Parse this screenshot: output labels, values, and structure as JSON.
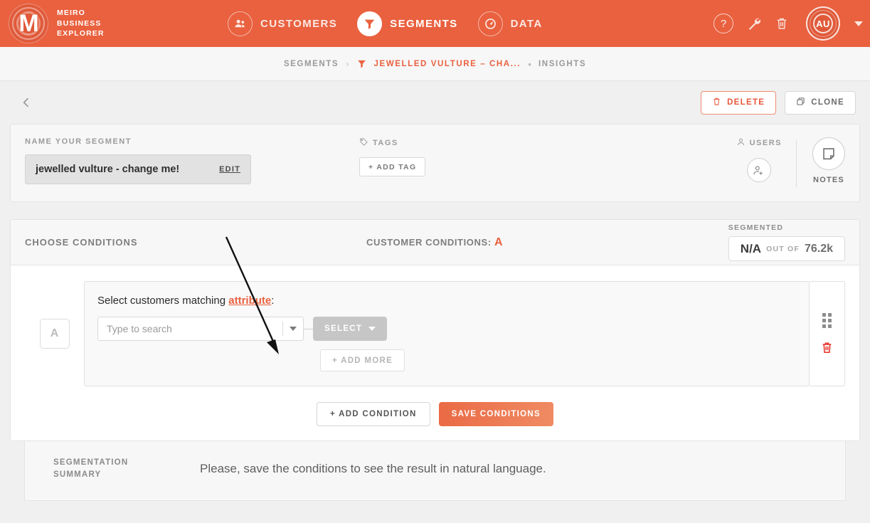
{
  "brand": {
    "logo_icon": "meiro-logo-icon",
    "logo_letter": "M",
    "line1": "MEIRO",
    "line2": "BUSINESS",
    "line3": "EXPLORER"
  },
  "topnav": {
    "items": [
      {
        "label": "CUSTOMERS",
        "icon": "customers-group-icon",
        "active": false
      },
      {
        "label": "SEGMENTS",
        "icon": "funnel-icon",
        "active": true
      },
      {
        "label": "DATA",
        "icon": "gauge-icon",
        "active": false
      }
    ],
    "help_icon": "question-mark-icon",
    "wrench_icon": "wrench-icon",
    "trash_icon": "trash-icon",
    "avatar_initials": "AU",
    "avatar_caret_icon": "chevron-down-icon"
  },
  "breadcrumb": {
    "root": "SEGMENTS",
    "separator": "›",
    "funnel_icon": "funnel-icon",
    "current": "JEWELLED VULTURE – CHA...",
    "dot": "•",
    "tail": "INSIGHTS"
  },
  "actionbar": {
    "back_icon": "chevron-left-icon",
    "delete_label": "DELETE",
    "delete_icon": "trash-icon",
    "clone_label": "CLONE",
    "clone_icon": "copy-icon"
  },
  "info": {
    "name_label": "NAME YOUR SEGMENT",
    "name_value": "jewelled vulture - change me!",
    "edit_label": "EDIT",
    "tags_label": "TAGS",
    "tags_icon": "tag-icon",
    "add_tag_label": "+  ADD TAG",
    "users_label": "USERS",
    "users_icon": "user-icon",
    "add_user_icon": "add-user-icon",
    "notes_label": "NOTES",
    "notes_icon": "note-icon"
  },
  "conditions": {
    "choose_label": "CHOOSE CONDITIONS",
    "customer_conditions_label": "CUSTOMER CONDITIONS:",
    "customer_conditions_letter": "A",
    "segmented_label": "SEGMENTED",
    "segmented_value": "N/A",
    "segmented_out_of": "OUT OF",
    "segmented_total": "76.2k",
    "row": {
      "letter": "A",
      "sentence_prefix": "Select customers matching ",
      "sentence_link": "attribute",
      "sentence_suffix": ":",
      "search_placeholder": "Type to search",
      "search_value": "",
      "search_caret_icon": "chevron-down-icon",
      "select_label": "SELECT",
      "select_caret_icon": "chevron-down-icon",
      "add_more_label": "+ ADD MORE",
      "drag_icon": "drag-handle-icon",
      "delete_icon": "trash-icon"
    },
    "add_condition_label": "+ ADD CONDITION",
    "save_conditions_label": "SAVE CONDITIONS"
  },
  "summary": {
    "label_line1": "SEGMENTATION",
    "label_line2": "SUMMARY",
    "text": "Please, save the conditions to see the result in natural language."
  },
  "colors": {
    "brand_orange": "#e9613f",
    "accent_link": "#e9613f",
    "danger_red": "#e8392e",
    "page_bg": "#f0f0f0"
  }
}
